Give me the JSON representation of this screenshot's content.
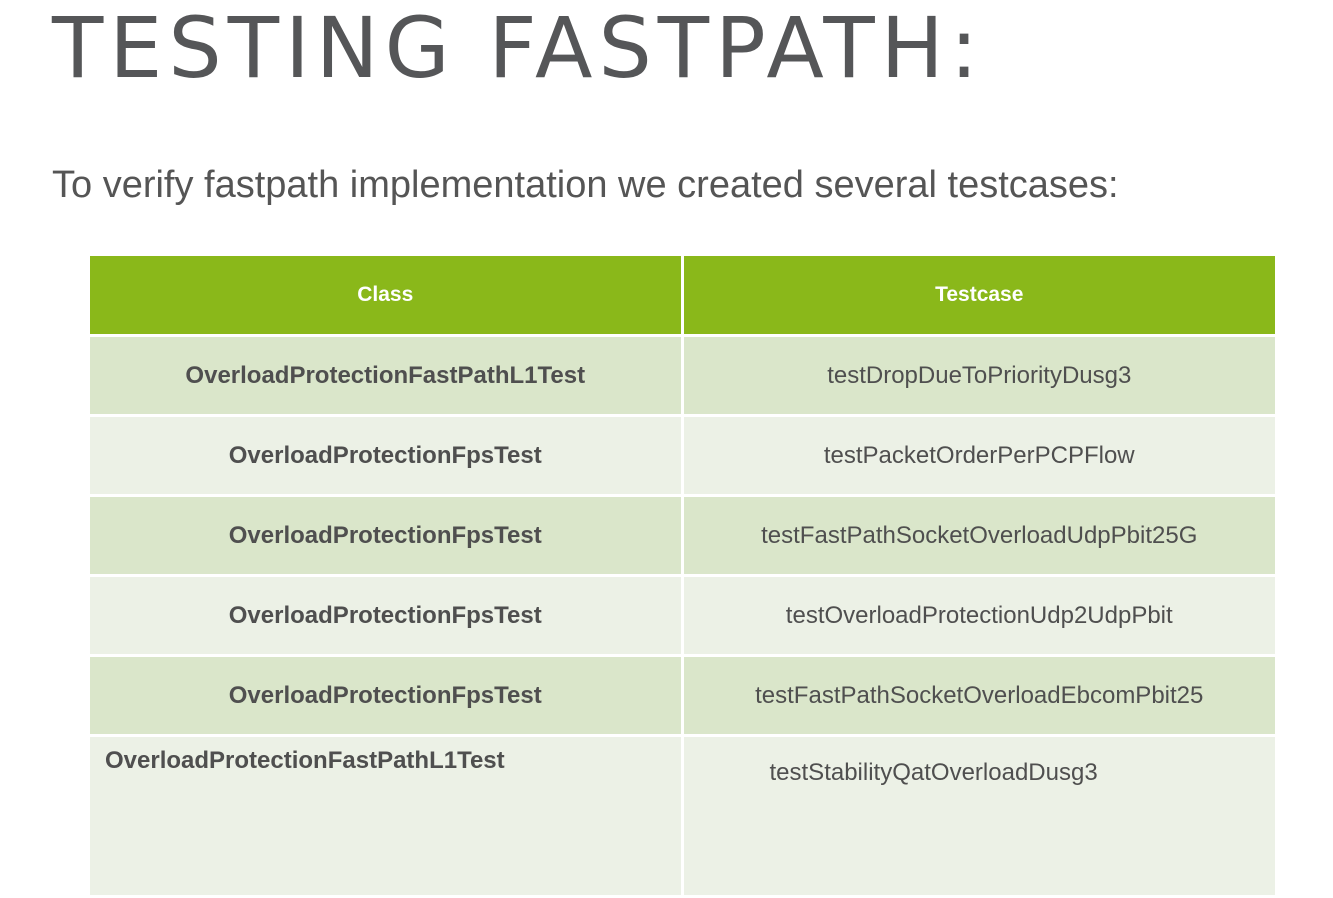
{
  "slide": {
    "title": "TESTING FASTPATH:",
    "intro": "To verify fastpath implementation we created several testcases:"
  },
  "table": {
    "headers": [
      "Class",
      "Testcase"
    ],
    "rows": [
      [
        "OverloadProtectionFastPathL1Test",
        "testDropDueToPriorityDusg3"
      ],
      [
        "OverloadProtectionFpsTest",
        "testPacketOrderPerPCPFlow"
      ],
      [
        "OverloadProtectionFpsTest",
        "testFastPathSocketOverloadUdpPbit25G"
      ],
      [
        "OverloadProtectionFpsTest",
        "testOverloadProtectionUdp2UdpPbit"
      ],
      [
        "OverloadProtectionFpsTest",
        "testFastPathSocketOverloadEbcomPbit25"
      ],
      [
        "OverloadProtectionFastPathL1Test",
        "testStabilityQatOverloadDusg3"
      ]
    ]
  },
  "colors": {
    "header_green": "#8ab81a",
    "row_dark": "#dae6ca",
    "row_light": "#ecf1e6",
    "text_gray": "#555555"
  }
}
